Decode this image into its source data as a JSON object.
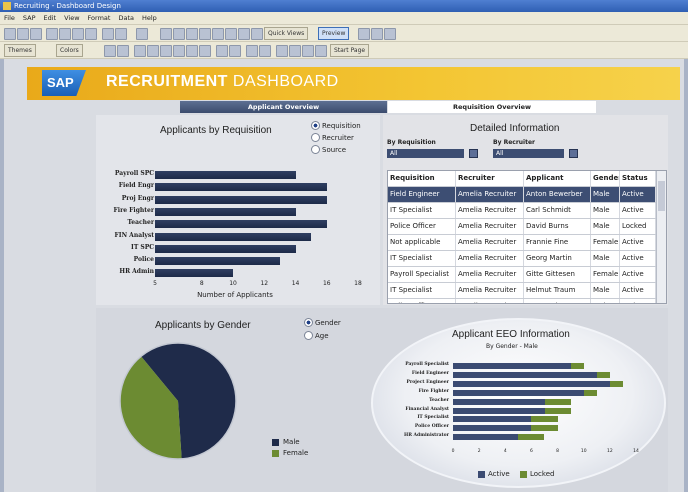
{
  "window": {
    "title": "Recruiting - Dashboard Design"
  },
  "menu": [
    "File",
    "SAP",
    "Edit",
    "View",
    "Format",
    "Data",
    "Help"
  ],
  "toolbar": {
    "quick_views": "Quick Views",
    "preview": "Preview",
    "themes": "Themes",
    "colors": "Colors",
    "start_page": "Start Page"
  },
  "banner": {
    "logo": "SAP",
    "title_bold": "RECRUITMENT",
    "title_light": " DASHBOARD"
  },
  "tabs": {
    "applicant": "Applicant Overview",
    "requisition": "Requisition Overview"
  },
  "req_panel": {
    "title": "Applicants by Requisition",
    "options": [
      {
        "label": "Requisition",
        "selected": true
      },
      {
        "label": "Recruiter",
        "selected": false
      },
      {
        "label": "Source",
        "selected": false
      }
    ],
    "xlabel": "Number of Applicants"
  },
  "detail": {
    "title": "Detailed Information",
    "by_requisition_label": "By Requisition",
    "by_requisition_value": "All",
    "by_recruiter_label": "By Recruiter",
    "by_recruiter_value": "All",
    "columns": [
      "Requisition",
      "Recruiter",
      "Applicant",
      "Gender",
      "Status"
    ],
    "rows": [
      [
        "Field Engineer",
        "Amelia Recruiter",
        "Anton Bewerber",
        "Male",
        "Active"
      ],
      [
        "IT Specialist",
        "Amelia Recruiter",
        "Carl Schmidt",
        "Male",
        "Active"
      ],
      [
        "Police Officer",
        "Amelia Recruiter",
        "David Burns",
        "Male",
        "Locked"
      ],
      [
        "Not applicable",
        "Amelia Recruiter",
        "Frannie Fine",
        "Female",
        "Active"
      ],
      [
        "IT Specialist",
        "Amelia Recruiter",
        "Georg Martin",
        "Male",
        "Active"
      ],
      [
        "Payroll Specialist",
        "Amelia Recruiter",
        "Gitte Gittesen",
        "Female",
        "Active"
      ],
      [
        "IT Specialist",
        "Amelia Recruiter",
        "Helmut Traum",
        "Male",
        "Active"
      ],
      [
        "Police Officer",
        "Amelia Recruiter",
        "James Johnson",
        "Male",
        "Active"
      ]
    ]
  },
  "gender_panel": {
    "title": "Applicants by Gender",
    "options": [
      {
        "label": "Gender",
        "selected": true
      },
      {
        "label": "Age",
        "selected": false
      }
    ]
  },
  "eeo_panel": {
    "title": "Applicant EEO Information",
    "subtitle": "By Gender - Male"
  },
  "colors": {
    "navy": "#1f2b4a",
    "green": "#6c8b32",
    "accent": "#f2be2e"
  },
  "chart_data": [
    {
      "type": "bar",
      "orientation": "horizontal",
      "title": "Applicants by Requisition",
      "xlabel": "Number of Applicants",
      "xlim": [
        5,
        18
      ],
      "xticks": [
        5,
        8,
        10,
        12,
        14,
        16,
        18
      ],
      "categories": [
        "Payroll SPC",
        "Field Engr",
        "Proj Engr",
        "Fire Fighter",
        "Teacher",
        "FIN Analyst",
        "IT SPC",
        "Police",
        "HR Admin"
      ],
      "values": [
        14,
        16,
        16,
        14,
        16,
        15,
        14,
        13,
        10
      ]
    },
    {
      "type": "pie",
      "title": "Applicants by Gender",
      "categories": [
        "Male",
        "Female"
      ],
      "values": [
        60,
        40
      ],
      "colors": [
        "#1f2b4a",
        "#6c8b32"
      ],
      "legend": "right"
    },
    {
      "type": "bar",
      "orientation": "horizontal",
      "stacked": true,
      "title": "Applicant EEO Information",
      "subtitle": "By Gender - Male",
      "categories": [
        "Payroll Specialist",
        "Field Engineer",
        "Project Engineer",
        "Fire Fighter",
        "Teacher",
        "Financial Analyst",
        "IT Specialist",
        "Police Officer",
        "HR Administrator"
      ],
      "xlim": [
        0,
        14
      ],
      "xticks": [
        0,
        2,
        4,
        6,
        8,
        10,
        12,
        14
      ],
      "series": [
        {
          "name": "Active",
          "values": [
            9,
            11,
            12,
            10,
            7,
            7,
            6,
            6,
            5
          ],
          "color": "#3b4b72"
        },
        {
          "name": "Locked",
          "values": [
            1,
            1,
            1,
            1,
            2,
            2,
            2,
            2,
            2
          ],
          "color": "#6c8b32"
        }
      ],
      "legend": "bottom"
    }
  ]
}
